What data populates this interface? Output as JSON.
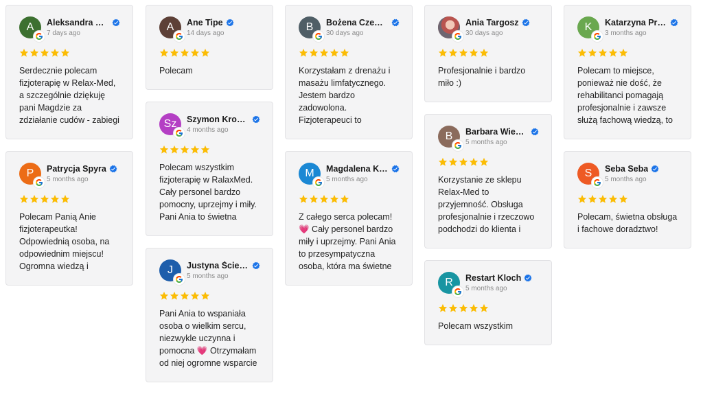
{
  "colors": {
    "star": "#fbbc04",
    "verified": "#1a73e8"
  },
  "columns": [
    [
      {
        "name": "Aleksandra Pac...",
        "initial": "A",
        "avatar_color": "#3c7030",
        "date": "7 days ago",
        "text": "Serdecznie polecam fizjoterapię w Relax-Med, a szczególnie dziękuję pani Magdzie za zdziałanie cudów - zabiegi postawiły"
      },
      {
        "name": "Patrycja Spyra",
        "initial": "P",
        "avatar_color": "#ec6c16",
        "date": "5 months ago",
        "text": "Polecam Panią Anie fizjoterapeutka! Odpowiednią osoba, na odpowiednim miejscu! Ogromna wiedzą i"
      }
    ],
    [
      {
        "name": "Ane Tipe",
        "initial": "A",
        "avatar_color": "#5d4037",
        "date": "14 days ago",
        "text": "Polecam"
      },
      {
        "name": "Szymon Krosny",
        "initial": "Sz",
        "avatar_color": "#b43fc4",
        "date": "4 months ago",
        "text": "Polecam wszystkim fizjoterapię w RalaxMed. Cały personel bardzo pomocny, uprzejmy i miły. Pani Ania to świetna"
      },
      {
        "name": "Justyna Ściebura",
        "initial": "J",
        "avatar_color": "#1e5eab",
        "date": "5 months ago",
        "text": "Pani Ania to wspaniała osoba o wielkim sercu, niezwykle uczynna i pomocna 💗 Otrzymałam od niej ogromne wsparcie"
      }
    ],
    [
      {
        "name": "Bożena Czempik",
        "initial": "B",
        "avatar_color": "#4f5e66",
        "date": "30 days ago",
        "text": "Korzystałam z drenażu i masażu limfatycznego. Jestem bardzo zadowolona. Fizjoterapeuci to"
      },
      {
        "name": "Magdalena Kieł...",
        "initial": "M",
        "avatar_color": "#1b88d4",
        "date": "5 months ago",
        "text": "Z całego serca polecam! 💗 Cały personel bardzo miły i uprzejmy. Pani Ania to przesympatyczna osoba, która ma świetne"
      }
    ],
    [
      {
        "name": "Ania Targosz",
        "initial": "",
        "avatar_color": "#a35a55",
        "photo": true,
        "date": "30 days ago",
        "text": "Profesjonalnie i bardzo miło :)"
      },
      {
        "name": "Barbara Wieczo...",
        "initial": "B",
        "avatar_color": "#8b6b5c",
        "date": "5 months ago",
        "text": "Korzystanie ze sklepu Relax-Med to przyjemność. Obsługa profesjonalnie i rzeczowo podchodzi do klienta i"
      },
      {
        "name": "Restart Kloch",
        "initial": "R",
        "avatar_color": "#1895a2",
        "date": "5 months ago",
        "text": "Polecam wszystkim"
      }
    ],
    [
      {
        "name": "Katarzyna Prus...",
        "initial": "K",
        "avatar_color": "#6aa84f",
        "date": "3 months ago",
        "text": "Polecam to miejsce, ponieważ nie dość, że rehabilitanci pomagają profesjonalnie i zawsze służą fachową wiedzą, to"
      },
      {
        "name": "Seba Seba",
        "initial": "S",
        "avatar_color": "#ee5a24",
        "date": "5 months ago",
        "text": "Polecam, świetna obsługa i fachowe doradztwo!"
      }
    ]
  ]
}
